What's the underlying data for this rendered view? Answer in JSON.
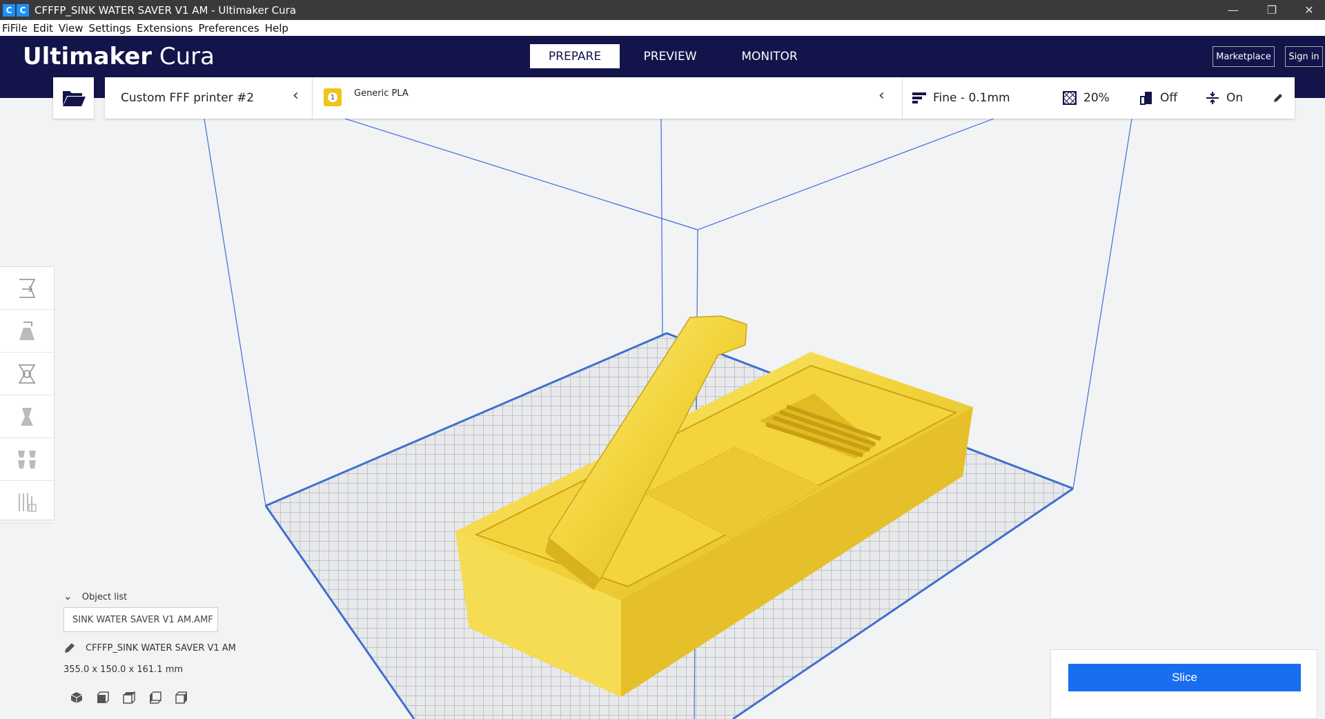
{
  "window": {
    "title": "CFFFP_SINK WATER SAVER V1 AM - Ultimaker Cura",
    "app_icon_1": "C",
    "app_icon_2": "C",
    "minimize": "—",
    "restore": "❐",
    "close": "✕"
  },
  "menu": [
    "Fi",
    "File",
    "Edit",
    "View",
    "Settings",
    "Extensions",
    "Preferences",
    "Help"
  ],
  "header": {
    "logo_bold": "Ultimaker",
    "logo_light": "Cura",
    "tabs": [
      "PREPARE",
      "PREVIEW",
      "MONITOR"
    ],
    "active_tab": "PREPARE",
    "marketplace": "Marketplace",
    "signin": "Sign in"
  },
  "printer": {
    "name": "Custom FFF printer #2",
    "material_extruder": "1",
    "material": "Generic PLA"
  },
  "print_settings": {
    "profile": "Fine - 0.1mm",
    "infill": "20%",
    "support": "Off",
    "adhesion": "On"
  },
  "object_list": {
    "toggle_label": "Object list",
    "file": "SINK WATER SAVER V1 AM.AMF",
    "object_name": "CFFFP_SINK WATER SAVER V1 AM",
    "dimensions": "355.0 x 150.0 x 161.1 mm"
  },
  "slice": {
    "button": "Slice"
  },
  "colors": {
    "header": "#12144a",
    "model": "#f2d33a",
    "accent": "#196ef0"
  }
}
